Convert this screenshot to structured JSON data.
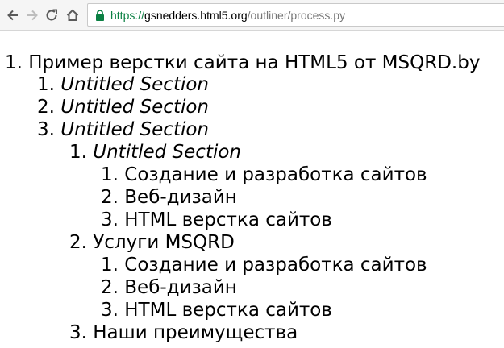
{
  "browser": {
    "url_scheme": "https://",
    "url_host": "gsnedders.html5.org",
    "url_path": "/outliner/process.py",
    "icons": [
      "back-icon",
      "forward-icon",
      "reload-icon",
      "home-icon",
      "lock-icon"
    ],
    "secure_color": "#0b8043"
  },
  "outline": {
    "root": {
      "num": "1.",
      "text": "Пример верстки сайта на HTML5 от MSQRD.by"
    },
    "l1_a": {
      "num": "1.",
      "text": "Untitled Section"
    },
    "l1_b": {
      "num": "2.",
      "text": "Untitled Section"
    },
    "l1_c": {
      "num": "3.",
      "text": "Untitled Section"
    },
    "l2_a": {
      "num": "1.",
      "text": "Untitled Section"
    },
    "l3_a1": {
      "num": "1.",
      "text": "Создание и разработка сайтов"
    },
    "l3_a2": {
      "num": "2.",
      "text": "Веб-дизайн"
    },
    "l3_a3": {
      "num": "3.",
      "text": "HTML верстка сайтов"
    },
    "l2_b": {
      "num": "2.",
      "text": "Услуги MSQRD"
    },
    "l3_b1": {
      "num": "1.",
      "text": "Создание и разработка сайтов"
    },
    "l3_b2": {
      "num": "2.",
      "text": "Веб-дизайн"
    },
    "l3_b3": {
      "num": "3.",
      "text": "HTML верстка сайтов"
    },
    "l2_c": {
      "num": "3.",
      "text": "Наши преимущества"
    }
  }
}
